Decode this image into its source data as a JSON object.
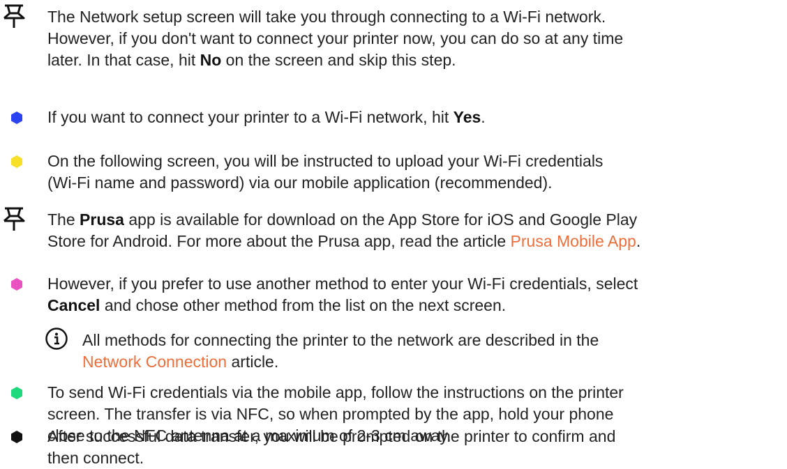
{
  "steps": [
    {
      "type": "note",
      "icon": "pin-icon",
      "lines": [
        [
          "The Network setup screen will take you through connecting to a Wi-Fi network."
        ],
        [
          "However, if you don't want to connect your printer now, you can do so at any time"
        ],
        [
          "later. In that case, hit ",
          {
            "b": "No"
          },
          " on the screen and skip this step."
        ]
      ]
    },
    {
      "type": "bullet",
      "icon": "blue-hexagon-icon",
      "color": "#2b43f0",
      "lines": [
        [
          "If you want to connect your printer to a Wi-Fi network, hit ",
          {
            "b": "Yes"
          },
          "."
        ]
      ]
    },
    {
      "type": "bullet",
      "icon": "yellow-hexagon-icon",
      "color": "#f7e027",
      "lines": [
        [
          "On the following screen, you will be instructed to upload your Wi-Fi credentials"
        ],
        [
          "(Wi-Fi name and password) via our mobile application (recommended)."
        ]
      ]
    },
    {
      "type": "note",
      "icon": "pin-icon",
      "lines": [
        [
          "The ",
          {
            "b": "Prusa"
          },
          " app is available for download on the App Store for iOS and Google Play"
        ],
        [
          "Store for Android. For more about the Prusa app, read the article ",
          {
            "link": "Prusa Mobile App"
          },
          "."
        ]
      ]
    },
    {
      "type": "bullet",
      "icon": "pink-hexagon-icon",
      "color": "#e952c1",
      "lines": [
        [
          "However, if you prefer to use another method to enter your Wi-Fi credentials, select"
        ],
        [
          {
            "b": "Cancel"
          },
          " and chose other method from the list on the next screen."
        ]
      ]
    },
    {
      "type": "info",
      "icon": "info-icon",
      "lines": [
        [
          "All methods for connecting the printer to the network are described in the"
        ],
        [
          {
            "link": "Network Connection"
          },
          " article."
        ]
      ]
    },
    {
      "type": "bullet",
      "icon": "green-hexagon-icon",
      "color": "#1ed87e",
      "lines": [
        [
          "To send Wi-Fi credentials via the mobile app, follow the instructions on the printer"
        ],
        [
          "screen. The transfer is via NFC, so when prompted by the app, hold your phone"
        ],
        [
          "close to the NFC antenna at a maximum of 2-3 cm away."
        ]
      ]
    },
    {
      "type": "bullet",
      "icon": "black-hexagon-icon",
      "color": "#111111",
      "lines": [
        [
          "After successful data transfer, you will be prompted on the printer to confirm and"
        ],
        [
          "then connect."
        ]
      ]
    }
  ],
  "colors": {
    "link": "#ec6e3a",
    "text": "#222222"
  }
}
